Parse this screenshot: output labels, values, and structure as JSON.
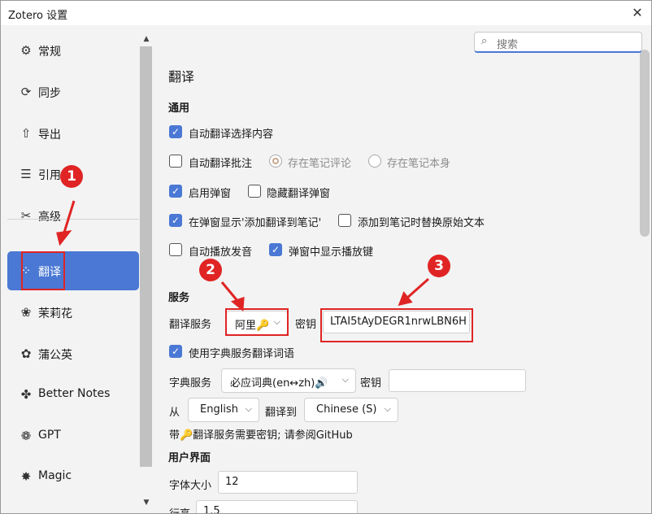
{
  "window": {
    "title": "Zotero 设置",
    "close_glyph": "✕"
  },
  "search": {
    "placeholder": "搜索",
    "icon": "search-icon"
  },
  "sidebar": {
    "items": [
      {
        "label": "常规",
        "icon": "⚙",
        "icon_name": "gear-icon"
      },
      {
        "label": "同步",
        "icon": "⟳",
        "icon_name": "sync-icon"
      },
      {
        "label": "导出",
        "icon": "⇧",
        "icon_name": "export-icon"
      },
      {
        "label": "引用",
        "icon": "☰",
        "icon_name": "cite-icon"
      },
      {
        "label": "高级",
        "icon": "✂",
        "icon_name": "tools-icon"
      },
      {
        "label": "翻译",
        "icon": "⁘",
        "icon_name": "translate-icon",
        "selected": true
      },
      {
        "label": "茉莉花",
        "icon": "❀",
        "icon_name": "jasmine-icon"
      },
      {
        "label": "蒲公英",
        "icon": "✿",
        "icon_name": "dandelion-icon"
      },
      {
        "label": "Better Notes",
        "icon": "✤",
        "icon_name": "better-notes-icon"
      },
      {
        "label": "GPT",
        "icon": "❁",
        "icon_name": "gpt-icon"
      },
      {
        "label": "Magic",
        "icon": "✸",
        "icon_name": "magic-icon"
      }
    ]
  },
  "main": {
    "heading": "翻译",
    "general": {
      "title": "通用",
      "auto_translate_selection": {
        "label": "自动翻译选择内容",
        "checked": true
      },
      "auto_translate_annotation": {
        "label": "自动翻译批注",
        "checked": false
      },
      "save_note_comment": {
        "label": "存在笔记评论",
        "selected": true
      },
      "save_note_body": {
        "label": "存在笔记本身",
        "selected": false
      },
      "enable_popup": {
        "label": "启用弹窗",
        "checked": true
      },
      "hide_popup": {
        "label": "隐藏翻译弹窗",
        "checked": false
      },
      "show_add_to_note": {
        "label": "在弹窗显示'添加翻译到笔记'",
        "checked": true
      },
      "replace_original": {
        "label": "添加到笔记时替换原始文本",
        "checked": false
      },
      "auto_play_audio": {
        "label": "自动播放发音",
        "checked": false
      },
      "show_play_button": {
        "label": "弹窗中显示播放键",
        "checked": true
      }
    },
    "service": {
      "title": "服务",
      "translate_service_label": "翻译服务",
      "translate_service_value": "阿里🔑",
      "key_label": "密钥",
      "key_value": "LTAI5tAyDEGR1nrwLBN6H",
      "use_dict_label": "使用字典服务翻译词语",
      "use_dict_checked": true,
      "dict_service_label": "字典服务",
      "dict_service_value": "必应词典(en↔zh)🔊",
      "dict_key_label": "密钥",
      "dict_key_value": "",
      "from_label": "从",
      "from_value": "English",
      "to_label": "翻译到",
      "to_value": "Chinese (S)",
      "note": "带🔑翻译服务需要密钥; 请参阅GitHub"
    },
    "ui": {
      "title": "用户界面",
      "font_size_label": "字体大小",
      "font_size_value": "12",
      "line_height_label": "行高",
      "line_height_value": "1.5"
    }
  },
  "annotations": {
    "badge1": "1",
    "badge2": "2",
    "badge3": "3",
    "color": "#e02424"
  },
  "colors": {
    "accent": "#4a78d4",
    "sidebar_bg": "#f3f3f3",
    "annotation_red": "#e02424"
  }
}
